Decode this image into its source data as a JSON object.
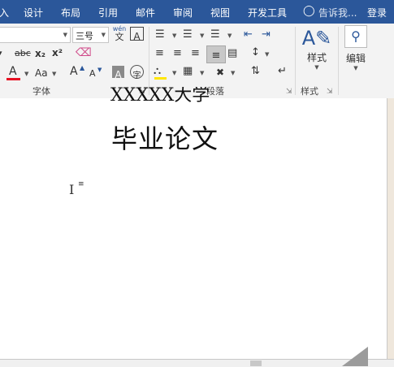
{
  "tabs": {
    "t0": "入",
    "t1": "设计",
    "t2": "布局",
    "t3": "引用",
    "t4": "邮件",
    "t5": "审阅",
    "t6": "视图",
    "t7": "开发工具",
    "tell": "告诉我...",
    "login": "登录"
  },
  "font": {
    "size_value": "三号",
    "phonetic_top": "wén",
    "phonetic_bottom": "文",
    "border_char": "A",
    "strike": "abc",
    "sub": "x₂",
    "sup": "x²",
    "color_a": "A",
    "case": "Aa",
    "grow": "A",
    "shrink": "A",
    "shade_char": "A",
    "enclose_char": "字",
    "group_label": "字体"
  },
  "paragraph": {
    "group_label": "段落"
  },
  "styles": {
    "label": "样式",
    "group_label": "样式"
  },
  "editing": {
    "label": "编辑"
  },
  "document": {
    "partial_line": "XXXXX大学",
    "title": "毕业论文"
  },
  "colors": {
    "ribbon_blue": "#2b579a",
    "font_red": "#e81123",
    "highlight_yellow": "#ffe600"
  }
}
